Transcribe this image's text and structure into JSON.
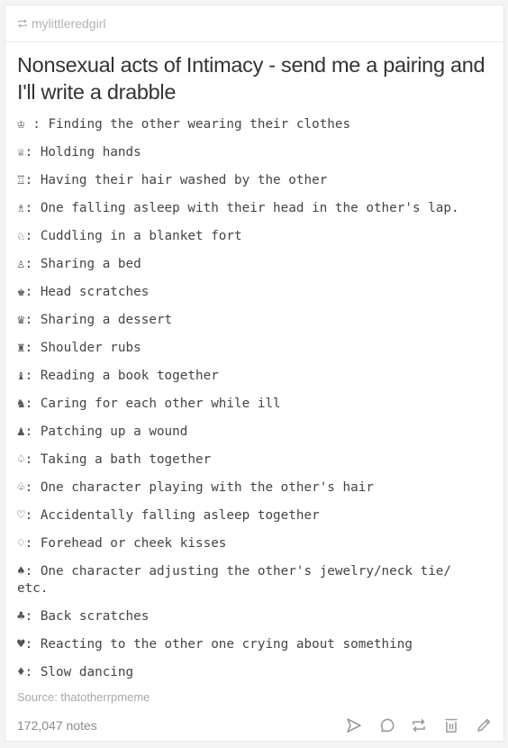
{
  "post": {
    "reblog_from": "mylittleredgirl",
    "title": "Nonsexual acts of Intimacy - send me a pairing and I'll write a drabble",
    "items": [
      {
        "symbol": "♔",
        "sep": " : ",
        "text": "Finding the other wearing their clothes"
      },
      {
        "symbol": "♕",
        "sep": ": ",
        "text": "Holding hands"
      },
      {
        "symbol": "♖",
        "sep": ": ",
        "text": "Having their hair washed by the other"
      },
      {
        "symbol": "♗",
        "sep": ": ",
        "text": "One falling asleep with their head in the other's lap."
      },
      {
        "symbol": "♘",
        "sep": ": ",
        "text": "Cuddling in a blanket fort"
      },
      {
        "symbol": "♙",
        "sep": ": ",
        "text": "Sharing a bed"
      },
      {
        "symbol": "♚",
        "sep": ": ",
        "text": "Head scratches"
      },
      {
        "symbol": "♛",
        "sep": ": ",
        "text": "Sharing a dessert"
      },
      {
        "symbol": "♜",
        "sep": ": ",
        "text": "Shoulder rubs"
      },
      {
        "symbol": "♝",
        "sep": ": ",
        "text": "Reading a book together"
      },
      {
        "symbol": "♞",
        "sep": ": ",
        "text": "Caring for each other while ill"
      },
      {
        "symbol": "♟",
        "sep": ": ",
        "text": "Patching up a wound"
      },
      {
        "symbol": "♤",
        "sep": ": ",
        "text": "Taking a bath together"
      },
      {
        "symbol": "♧",
        "sep": ": ",
        "text": "One character playing with the other's hair"
      },
      {
        "symbol": "♡",
        "sep": ": ",
        "text": "Accidentally falling asleep together"
      },
      {
        "symbol": "♢",
        "sep": ": ",
        "text": "Forehead or cheek kisses"
      },
      {
        "symbol": "♠",
        "sep": ": ",
        "text": "One character adjusting the other's jewelry/neck tie/ etc."
      },
      {
        "symbol": "♣",
        "sep": ": ",
        "text": "Back scratches"
      },
      {
        "symbol": "♥",
        "sep": ": ",
        "text": "Reacting to the other one crying about something"
      },
      {
        "symbol": "♦",
        "sep": ": ",
        "text": "Slow dancing"
      }
    ],
    "source": "Source: thatotherrpmeme",
    "notes": "172,047 notes",
    "actions": [
      {
        "name": "share",
        "icon": "send-icon"
      },
      {
        "name": "reply",
        "icon": "comment-icon"
      },
      {
        "name": "reblog",
        "icon": "reblog-icon"
      },
      {
        "name": "delete",
        "icon": "trash-icon"
      },
      {
        "name": "edit",
        "icon": "pencil-icon"
      }
    ]
  },
  "colors": {
    "background": "#f4f4f4",
    "card": "#ffffff",
    "icon": "#9a9a9a",
    "text": "#444444"
  }
}
